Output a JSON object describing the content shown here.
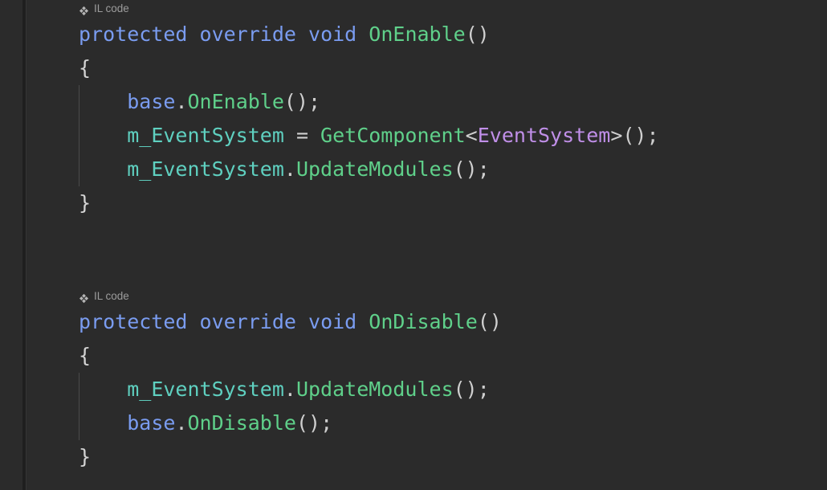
{
  "editor": {
    "background_color": "#2b2b2b",
    "font_size_px": 25,
    "language": "csharp"
  },
  "colors": {
    "keyword": "#7a9cf0",
    "method": "#5fd08a",
    "type": "#c08fe8",
    "field": "#5fd0c0",
    "punctuation": "#cfcfcf",
    "lens_text": "#9c9c9c",
    "indent_guide": "#4a4a4a",
    "gutter_stripe": "#1f1f1f"
  },
  "lens": {
    "icon_name": "four-diamond-icon",
    "label": "IL code"
  },
  "blocks": [
    {
      "lens_label": "IL code",
      "signature": {
        "keyword1": "protected",
        "keyword2": "override",
        "keyword3": "void",
        "name": "OnEnable",
        "parens": "()"
      },
      "open_brace": "{",
      "close_brace": "}",
      "statements": [
        {
          "parts": [
            {
              "text": "base",
              "kind": "kw"
            },
            {
              "text": ".",
              "kind": "pun"
            },
            {
              "text": "OnEnable",
              "kind": "mth"
            },
            {
              "text": "();",
              "kind": "pun"
            }
          ]
        },
        {
          "parts": [
            {
              "text": "m_EventSystem",
              "kind": "var"
            },
            {
              "text": " = ",
              "kind": "pun"
            },
            {
              "text": "GetComponent",
              "kind": "mth"
            },
            {
              "text": "<",
              "kind": "pun"
            },
            {
              "text": "EventSystem",
              "kind": "typ"
            },
            {
              "text": ">();",
              "kind": "pun"
            }
          ]
        },
        {
          "parts": [
            {
              "text": "m_EventSystem",
              "kind": "var"
            },
            {
              "text": ".",
              "kind": "pun"
            },
            {
              "text": "UpdateModules",
              "kind": "mth"
            },
            {
              "text": "();",
              "kind": "pun"
            }
          ]
        }
      ]
    },
    {
      "lens_label": "IL code",
      "signature": {
        "keyword1": "protected",
        "keyword2": "override",
        "keyword3": "void",
        "name": "OnDisable",
        "parens": "()"
      },
      "open_brace": "{",
      "close_brace": "}",
      "statements": [
        {
          "parts": [
            {
              "text": "m_EventSystem",
              "kind": "var"
            },
            {
              "text": ".",
              "kind": "pun"
            },
            {
              "text": "UpdateModules",
              "kind": "mth"
            },
            {
              "text": "();",
              "kind": "pun"
            }
          ]
        },
        {
          "parts": [
            {
              "text": "base",
              "kind": "kw"
            },
            {
              "text": ".",
              "kind": "pun"
            },
            {
              "text": "OnDisable",
              "kind": "mth"
            },
            {
              "text": "();",
              "kind": "pun"
            }
          ]
        }
      ]
    }
  ]
}
